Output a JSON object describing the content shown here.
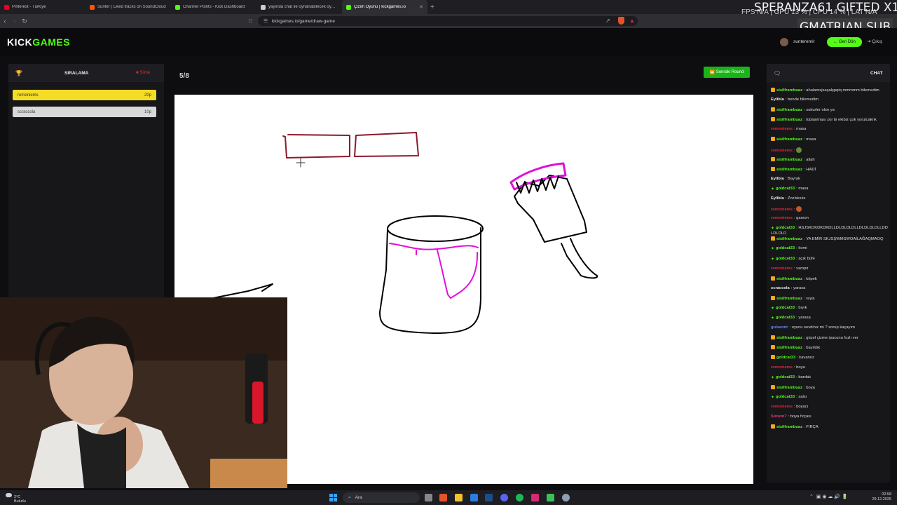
{
  "browser": {
    "tabs": [
      {
        "label": "Pinterest - Türkiye",
        "color": "#e60023",
        "active": false
      },
      {
        "label": "Sunter | Liked tracks on SoundCloud",
        "color": "#ff5500",
        "active": false
      },
      {
        "label": "Channel Points - Kick Dashboard",
        "color": "#53fc18",
        "active": false
      },
      {
        "label": "yayında chat ile oynanabilecek oyun...",
        "color": "#cccccc",
        "active": false
      },
      {
        "label": "Çizim Oyunu | kickgames.io",
        "color": "#53fc18",
        "active": true
      }
    ],
    "url": "kickgames.io/game/draw-game"
  },
  "overlay": {
    "fps": "FPS N/A  |  GPU 13 %  |  CPU 14 %  |  LAT N/A",
    "sub_alert": "SPERANZA61  GIFTED X1",
    "sub_name": "GMATRIAN  SUB"
  },
  "site": {
    "logo_kick": "KICK",
    "logo_games": "GAMES",
    "username": "sunteremir",
    "back_label": "Geri Dön",
    "logout_label": "Çıkış"
  },
  "leaderboard": {
    "title": "SIRALAMA",
    "delete_label": "Silme",
    "rows": [
      {
        "name": "remoniems",
        "score": "20p"
      },
      {
        "name": "scraccola",
        "score": "10p"
      }
    ]
  },
  "game": {
    "round": "5/8",
    "next_round_label": "Sonraki Round"
  },
  "chat": {
    "title": "CHAT",
    "messages": [
      {
        "user": "sisilframbuaz",
        "color": "c-green",
        "badge": "sub",
        "text": "ahalamsjsaşalşpqiq mmmmm bilemedim"
      },
      {
        "user": "Eylibla",
        "color": "c-white",
        "badge": "",
        "text": "bende bilemedim"
      },
      {
        "user": "sisilframbuaz",
        "color": "c-green",
        "badge": "sub",
        "text": "sukurler olsn ya"
      },
      {
        "user": "sisilframbuaz",
        "color": "c-green",
        "badge": "sub",
        "text": "toplanması zor bi ekibiz çok yorulcaknk"
      },
      {
        "user": "remoniems",
        "color": "c-red",
        "badge": "",
        "text": "masa"
      },
      {
        "user": "sisilframbuaz",
        "color": "c-green",
        "badge": "sub",
        "text": "masa"
      },
      {
        "user": "remoniems",
        "color": "c-red",
        "badge": "",
        "text": "",
        "emote": "#6b8a3a"
      },
      {
        "user": "sisilframbuaz",
        "color": "c-green",
        "badge": "sub",
        "text": "allah"
      },
      {
        "user": "sisilframbuaz",
        "color": "c-green",
        "badge": "sub",
        "text": "HADİ"
      },
      {
        "user": "Eylibla",
        "color": "c-white",
        "badge": "",
        "text": "Bayrak"
      },
      {
        "user": "goldcat33",
        "color": "c-green",
        "badge": "gift",
        "text": "masa"
      },
      {
        "user": "Eylibla",
        "color": "c-white",
        "badge": "",
        "text": "Znzlsksks"
      },
      {
        "user": "remoniems",
        "color": "c-red",
        "badge": "",
        "text": "",
        "emote": "#c8562a"
      },
      {
        "user": "remoniems",
        "color": "c-red",
        "badge": "",
        "text": "garson"
      },
      {
        "user": "goldcat33",
        "color": "c-green",
        "badge": "gift",
        "text": "HSJSKDKDKDKDLLDLDLDLDLLDLDLDLDLLDDLDLDLD"
      },
      {
        "user": "sisilframbuaz",
        "color": "c-green",
        "badge": "sub",
        "text": "YA EMİR SKJSŞWMSWOAİLAĞAQMAOQ"
      },
      {
        "user": "goldcat33",
        "color": "c-green",
        "badge": "gift",
        "text": "komi"
      },
      {
        "user": "goldcat33",
        "color": "c-green",
        "badge": "gift",
        "text": "açık büfe"
      },
      {
        "user": "remoniems",
        "color": "c-red",
        "badge": "",
        "text": "vampir"
      },
      {
        "user": "sisilframbuaz",
        "color": "c-green",
        "badge": "sub",
        "text": "köpek"
      },
      {
        "user": "scraccola",
        "color": "c-white",
        "badge": "",
        "text": "yarasa"
      },
      {
        "user": "sisilframbuaz",
        "color": "c-green",
        "badge": "sub",
        "text": "reyis"
      },
      {
        "user": "goldcat33",
        "color": "c-green",
        "badge": "gift",
        "text": "bıyık"
      },
      {
        "user": "goldcat33",
        "color": "c-green",
        "badge": "gift",
        "text": "yarasa"
      },
      {
        "user": "gulsendr",
        "color": "c-blue",
        "badge": "",
        "text": "oyunu sevdiniz mi ? sorup kaçayım"
      },
      {
        "user": "sisilframbuaz",
        "color": "c-green",
        "badge": "sub",
        "text": "güzel çizme ipucunu hızlı ver"
      },
      {
        "user": "sisilframbuaz",
        "color": "c-green",
        "badge": "sub",
        "text": "bayıldık"
      },
      {
        "user": "goldcat33",
        "color": "c-green",
        "badge": "sub",
        "text": "kavanoz"
      },
      {
        "user": "remoniems",
        "color": "c-red",
        "badge": "",
        "text": "boya"
      },
      {
        "user": "goldcat33",
        "color": "c-green",
        "badge": "gift",
        "text": "bardak"
      },
      {
        "user": "sisilframbuaz",
        "color": "c-green",
        "badge": "sub",
        "text": "boya"
      },
      {
        "user": "goldcat33",
        "color": "c-green",
        "badge": "gift",
        "text": "salsı"
      },
      {
        "user": "remoniems",
        "color": "c-red",
        "badge": "",
        "text": "boyacı"
      },
      {
        "user": "Sonem7",
        "color": "c-pink",
        "badge": "",
        "text": "boya fırçası"
      },
      {
        "user": "sisilframbuaz",
        "color": "c-green",
        "badge": "sub",
        "text": "FIRÇA"
      }
    ]
  },
  "taskbar": {
    "temp": "2°C",
    "weather": "Bulutlu",
    "search_label": "Ara",
    "time": "02:58",
    "date": "29.12.2025"
  }
}
